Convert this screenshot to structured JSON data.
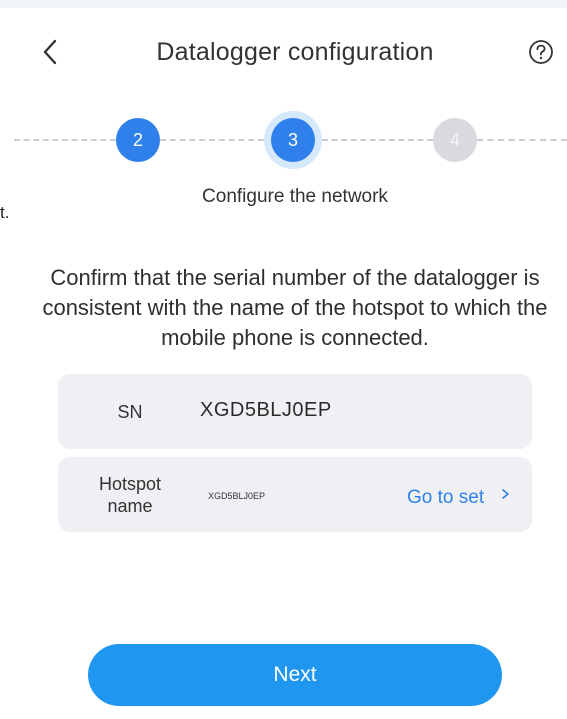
{
  "header": {
    "title": "Datalogger configuration",
    "back_icon": "chevron-left-icon",
    "help_icon": "question-circle-icon"
  },
  "stepper": {
    "steps": [
      {
        "label": "2",
        "state": "completed"
      },
      {
        "label": "3",
        "state": "current"
      },
      {
        "label": "4",
        "state": "upcoming"
      }
    ],
    "caption": "Configure the network"
  },
  "edge_fragment": "t.",
  "instruction": "Confirm that the serial number of the datalogger is consistent with the name of the hotspot to which the mobile phone is connected.",
  "sn_card": {
    "label": "SN",
    "value": "XGD5BLJ0EP"
  },
  "hotspot_card": {
    "label_line1": "Hotspot",
    "label_line2": "name",
    "value": "XGD5BLJ0EP",
    "action_label": "Go to set",
    "action_icon": "chevron-right-icon"
  },
  "next_button": {
    "label": "Next"
  },
  "colors": {
    "accent": "#2f80ea",
    "button": "#1f97f1",
    "card_bg": "#eef0f3",
    "step_upcoming": "#d9dadd",
    "step_halo": "#d6e8fb"
  }
}
